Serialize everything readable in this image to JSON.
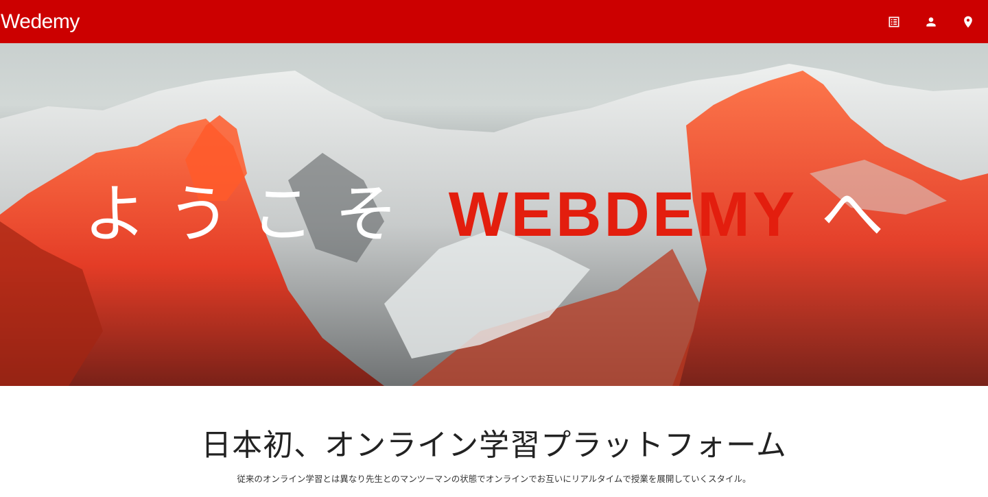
{
  "navbar": {
    "brand": "Wedemy",
    "icons": [
      {
        "name": "list-icon"
      },
      {
        "name": "person-icon"
      },
      {
        "name": "location-icon"
      }
    ],
    "background": "#cc0000"
  },
  "hero": {
    "title_prefix": "ようこそ",
    "title_brand": "WEBDEMY",
    "title_suffix": "へ",
    "brand_color": "#e31e0e"
  },
  "intro": {
    "heading": "日本初、オンライン学習プラットフォーム",
    "description": "従来のオンライン学習とは異なり先生とのマンツーマンの状態でオンラインでお互いにリアルタイムで授業を展開していくスタイル。"
  }
}
